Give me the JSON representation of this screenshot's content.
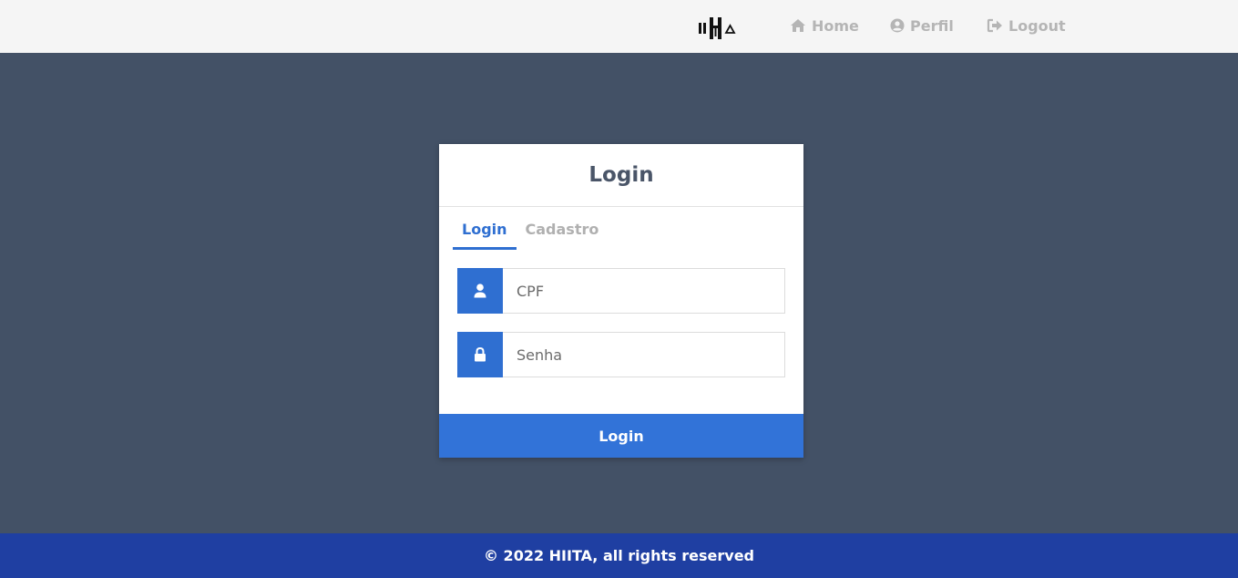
{
  "navbar": {
    "logo_text": "IIHA",
    "links": [
      {
        "label": "Home",
        "icon": "home-icon"
      },
      {
        "label": "Perfil",
        "icon": "user-circle-icon"
      },
      {
        "label": "Logout",
        "icon": "sign-out-icon"
      }
    ]
  },
  "card": {
    "title": "Login",
    "tabs": [
      {
        "label": "Login",
        "active": true
      },
      {
        "label": "Cadastro",
        "active": false
      }
    ],
    "fields": {
      "cpf": {
        "placeholder": "CPF",
        "value": "",
        "icon": "user-icon"
      },
      "senha": {
        "placeholder": "Senha",
        "value": "",
        "icon": "lock-icon"
      }
    },
    "submit_label": "Login"
  },
  "footer": {
    "text": "© 2022 HIITA, all rights reserved"
  },
  "colors": {
    "accent": "#3273d8",
    "background": "#435166",
    "navbar": "#f5f5f5",
    "footer": "#1f3fa2",
    "nav_link": "#b5b5b5"
  }
}
